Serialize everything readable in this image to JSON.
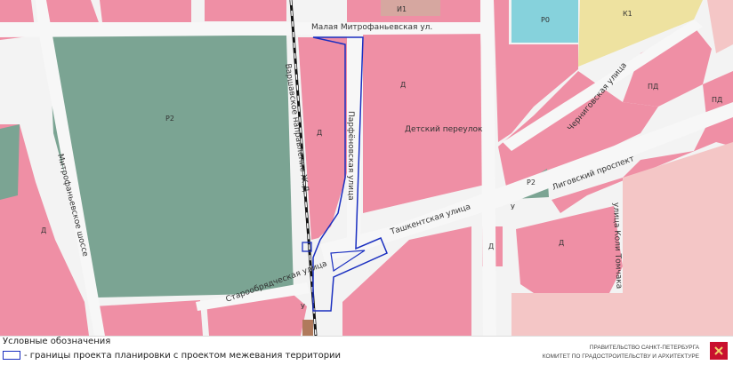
{
  "streets": {
    "malaya_mitrofanyevskaya": "Малая Митрофаньевская ул.",
    "varshavskoe": "Варшавское направление Ж.Д.",
    "mitrofanyevskoe_shosse": "Митрофаньевское шоссе",
    "parfenovskaya": "Парфёновская улица",
    "detskiy": "Детский переулок",
    "tashkentskaya": "Ташкентская улица",
    "ligovskiy": "Лиговский проспект",
    "chernigovskaya": "Черниговская улица",
    "koli_tomchaka": "улица Коли Томчака",
    "staroobryadcheskaya": "Старообрядческая улица"
  },
  "zones": {
    "r2_left": "Р2",
    "d_left": "Д",
    "d_center": "Д",
    "d_upper": "Д",
    "i1": "И1",
    "r0": "Р0",
    "k1": "К1",
    "pd_1": "ПД",
    "pd_2": "ПД",
    "r2_small": "Р2",
    "u_right": "У",
    "d_square": "Д",
    "d_lower": "Д",
    "u_bottom": "У"
  },
  "legend": {
    "title": "Условные обозначения",
    "boundary": "- границы проекта планировки с проектом межевания территории"
  },
  "org": {
    "line1": "ПРАВИТЕЛЬСТВО САНКТ-ПЕТЕРБУРГА",
    "line2": "КОМИТЕТ ПО ГРАДОСТРОИТЕЛЬСТВУ И АРХИТЕКТУРЕ"
  },
  "colors": {
    "residential_pink": "#ef8fa5",
    "park_green": "#7ba493",
    "business_light": "#f4c6c6",
    "industrial_yellow": "#eee2a0",
    "recreation_cyan": "#86d2dc",
    "boundary_blue": "#1a2fc0",
    "emblem_red": "#c8102e"
  }
}
